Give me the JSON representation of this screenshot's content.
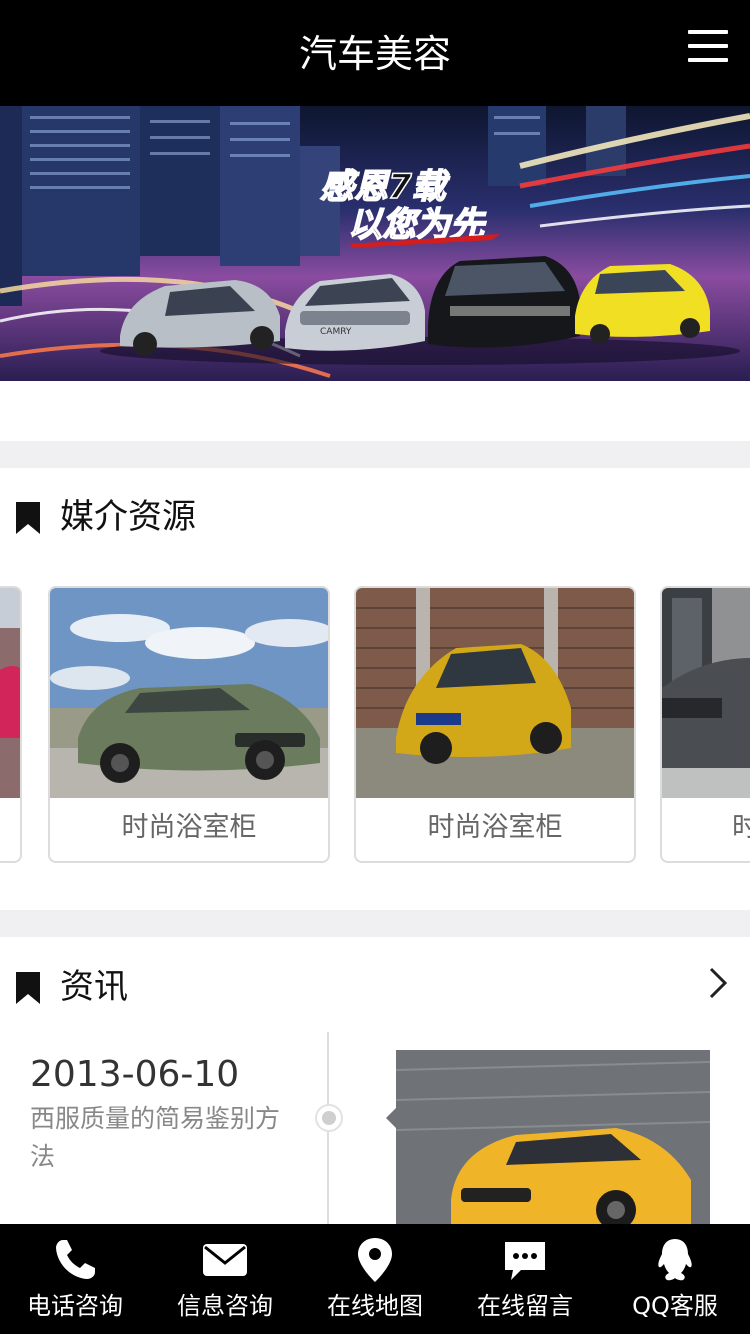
{
  "header": {
    "title": "汽车美容"
  },
  "banner": {
    "headline": "感恩7载",
    "subline": "以您为先",
    "car_badge": "CAMRY"
  },
  "sections": {
    "media": {
      "title": "媒介资源"
    },
    "news": {
      "title": "资讯"
    }
  },
  "media_cards": [
    {
      "label": "时尚浴室柜"
    },
    {
      "label": "时尚浴室柜"
    },
    {
      "label": "时尚浴室柜"
    }
  ],
  "news": {
    "date": "2013-06-10",
    "title": "西服质量的简易鉴别方法"
  },
  "bottom_nav": [
    {
      "label": "电话咨询",
      "icon": "phone-icon"
    },
    {
      "label": "信息咨询",
      "icon": "mail-icon"
    },
    {
      "label": "在线地图",
      "icon": "map-pin-icon"
    },
    {
      "label": "在线留言",
      "icon": "chat-icon"
    },
    {
      "label": "QQ客服",
      "icon": "qq-icon"
    }
  ],
  "colors": {
    "header_bg": "#000000",
    "nav_bg": "#000000",
    "divider": "#f0f0f2",
    "banner_red": "#d61c1c",
    "car_yellow": "#f0c21a"
  }
}
